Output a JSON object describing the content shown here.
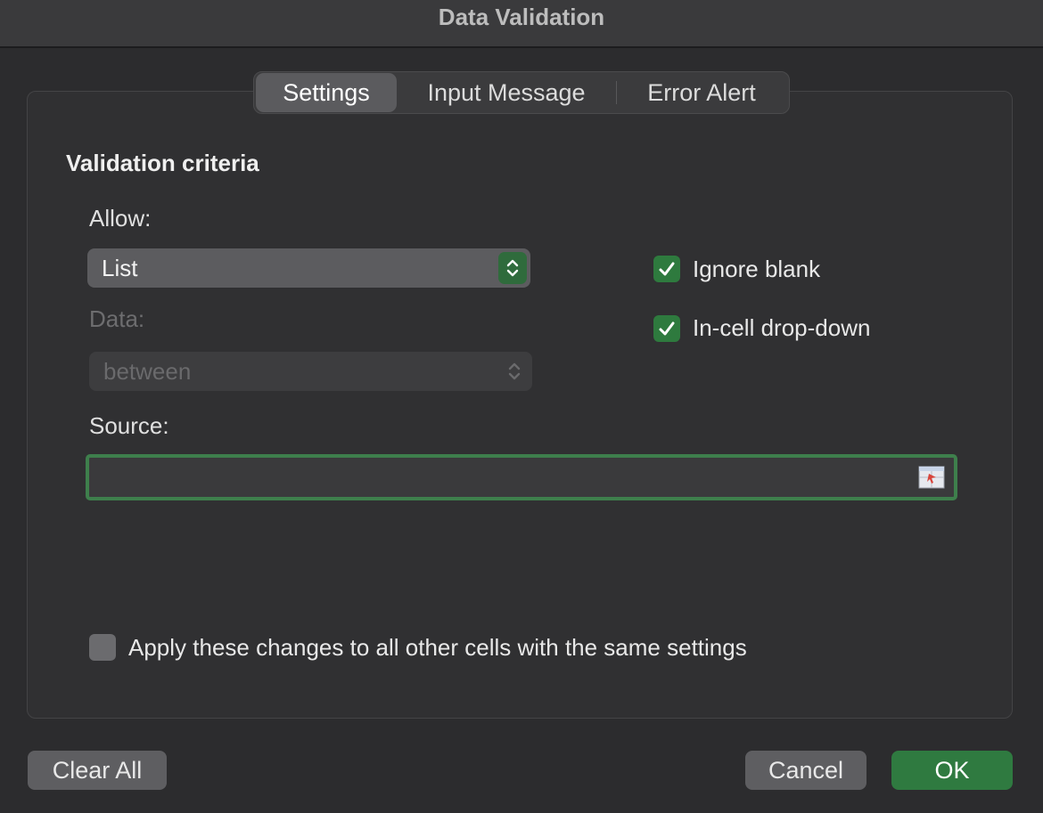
{
  "window": {
    "title": "Data Validation"
  },
  "tabs": [
    {
      "label": "Settings",
      "active": true
    },
    {
      "label": "Input Message",
      "active": false
    },
    {
      "label": "Error Alert",
      "active": false
    }
  ],
  "criteria": {
    "heading": "Validation criteria",
    "allow_label": "Allow:",
    "allow_value": "List",
    "data_label": "Data:",
    "data_value": "between",
    "source_label": "Source:",
    "source_value": ""
  },
  "options": {
    "ignore_blank": {
      "label": "Ignore blank",
      "checked": true
    },
    "in_cell_dropdown": {
      "label": "In-cell drop-down",
      "checked": true
    },
    "apply_all": {
      "label": "Apply these changes to all other cells with the same settings",
      "checked": false
    }
  },
  "buttons": {
    "clear_all": "Clear All",
    "cancel": "Cancel",
    "ok": "OK"
  },
  "colors": {
    "accent_green": "#2f7a40",
    "background": "#2c2c2e"
  },
  "icons": {
    "stepper": "chevron-up-down-icon",
    "checkmark": "checkmark-icon",
    "range_picker": "range-selector-icon"
  }
}
